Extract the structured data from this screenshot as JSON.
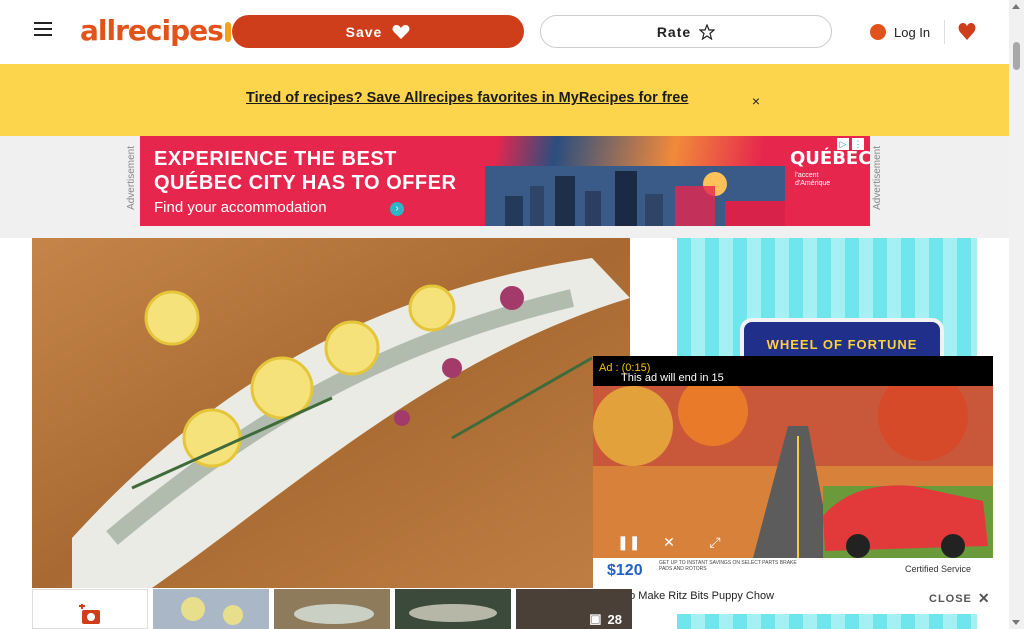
{
  "header": {
    "logo_text": "allrecipes",
    "save_label": "Save",
    "rate_label": "Rate",
    "login_label": "Log In"
  },
  "banner": {
    "text": "Tired of recipes? Save Allrecipes favorites in MyRecipes for free",
    "close_icon": "×"
  },
  "top_ad": {
    "label": "Advertisement",
    "line1": "EXPERIENCE THE BEST",
    "line2": "QUÉBEC CITY HAS TO OFFER",
    "line3": "Find your accommodation",
    "brand": "QUÉBEC",
    "brand_sub": "l'accent d'Amérique"
  },
  "side_ad": {
    "logo_text": "WHEEL OF FORTUNE"
  },
  "video": {
    "ad_timer": "Ad : (0:15)",
    "ad_end_text": "This ad will end in 15",
    "footer_price": "$120",
    "footer_left": "GET UP TO  INSTANT SAVINGS ON SELECT PARTS BRAKE PADS AND ROTORS",
    "footer_right": "Certified Service",
    "title": "How to Make Ritz Bits Puppy Chow",
    "close_label": "CLOSE"
  },
  "gallery": {
    "photo_count": "28"
  },
  "colors": {
    "brand_orange": "#ce3e1a",
    "banner_yellow": "#fcd54c",
    "ad_red": "#e6264d"
  }
}
